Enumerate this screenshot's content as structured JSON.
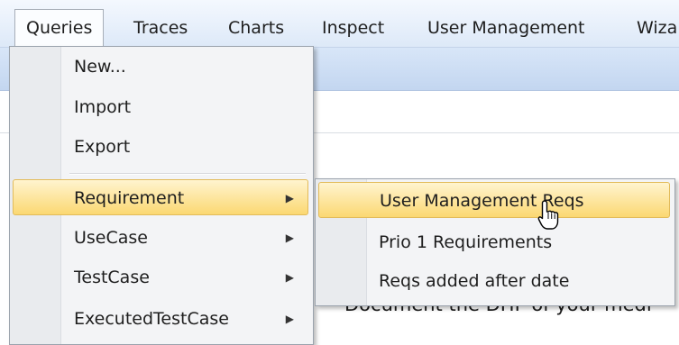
{
  "menubar": {
    "items": [
      {
        "label": "Queries"
      },
      {
        "label": "Traces"
      },
      {
        "label": "Charts"
      },
      {
        "label": "Inspect"
      },
      {
        "label": "User Management"
      },
      {
        "label": "Wiza"
      }
    ]
  },
  "queries_menu": {
    "items": [
      {
        "label": "New..."
      },
      {
        "label": "Import"
      },
      {
        "label": "Export"
      },
      {
        "label": "Requirement"
      },
      {
        "label": "UseCase"
      },
      {
        "label": "TestCase"
      },
      {
        "label": "ExecutedTestCase"
      }
    ]
  },
  "requirement_submenu": {
    "items": [
      {
        "label": "User Management Reqs"
      },
      {
        "label": "Prio 1 Requirements"
      },
      {
        "label": "Reqs added after date"
      }
    ]
  },
  "background": {
    "body_text": "Document the DHF of your medi"
  },
  "icons": {
    "submenu_arrow": "▶",
    "cursor": "mouse-pointer-icon"
  },
  "colors": {
    "highlight_top": "#fff4cf",
    "highlight_bottom": "#fbd872",
    "menubar_bg": "#dde9f8"
  }
}
